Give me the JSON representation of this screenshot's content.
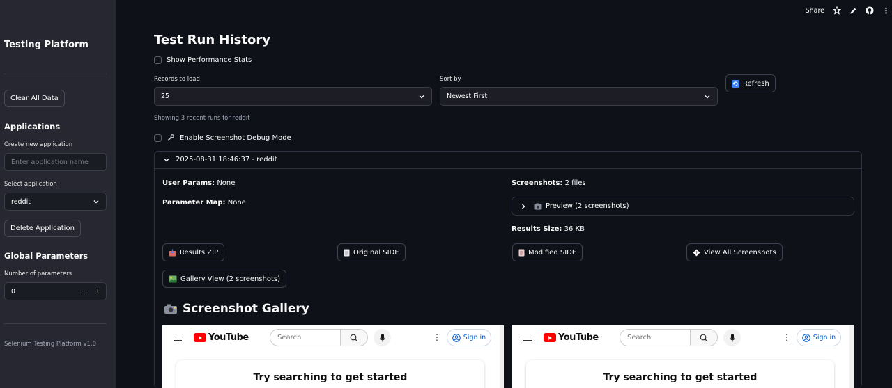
{
  "topbar": {
    "share": "Share"
  },
  "sidebar": {
    "title": "Testing Platform",
    "clear_button": "Clear All Data",
    "applications_header": "Applications",
    "create_label": "Create new application",
    "create_placeholder": "Enter application name",
    "select_label": "Select application",
    "select_value": "reddit",
    "delete_button": "Delete Application",
    "global_params_header": "Global Parameters",
    "num_params_label": "Number of parameters",
    "num_params_value": "0",
    "footer": "Selenium Testing Platform v1.0"
  },
  "main": {
    "title": "Test Run History",
    "show_perf": "Show Performance Stats",
    "records_label": "Records to load",
    "records_value": "25",
    "sort_label": "Sort by",
    "sort_value": "Newest First",
    "refresh_button": "Refresh",
    "showing_text": "Showing 3 recent runs for reddit",
    "debug_mode": "Enable Screenshot Debug Mode"
  },
  "run": {
    "header": "2025-08-31 18:46:37 - reddit",
    "user_params_label": "User Params:",
    "user_params_value": "None",
    "param_map_label": "Parameter Map:",
    "param_map_value": "None",
    "screenshots_label": "Screenshots:",
    "screenshots_value": "2 files",
    "preview_label": "Preview (2 screenshots)",
    "results_size_label": "Results Size:",
    "results_size_value": "36 KB",
    "results_zip": "Results ZIP",
    "original_side": "Original SIDE",
    "modified_side": "Modified SIDE",
    "view_all": "View All Screenshots",
    "gallery_view": "Gallery View (2 screenshots)",
    "gallery_title": "Screenshot Gallery"
  },
  "youtube": {
    "logo": "YouTube",
    "search_placeholder": "Search",
    "sign_in": "Sign in",
    "prompt": "Try searching to get started"
  },
  "colors": {
    "background": "#0e1117",
    "sidebar": "#262730",
    "youtube_red": "#ff0000",
    "link_blue": "#065fd4"
  }
}
